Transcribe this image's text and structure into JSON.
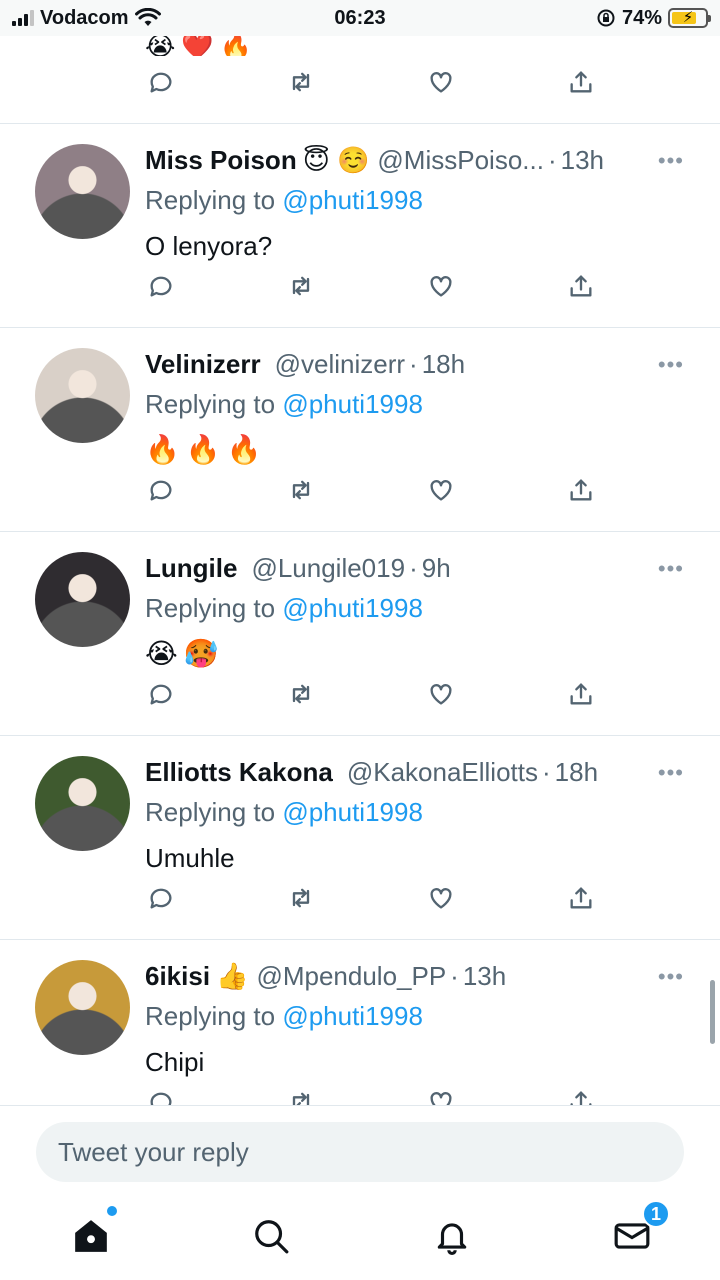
{
  "status_bar": {
    "carrier": "Vodacom",
    "time": "06:23",
    "battery_percent": "74%",
    "battery_level": 0.74
  },
  "top_partial": {
    "emojis": "😭❤️🔥"
  },
  "reply_prefix": "Replying to",
  "tweets": [
    {
      "name": "Miss Poison",
      "name_emoji": "😇 ☺️",
      "handle": "@MissPoiso...",
      "time": "13h",
      "mention": "@phuti1998",
      "text": "O lenyora?",
      "avatar_bg": "#8f7f86"
    },
    {
      "name": "Velinizerr",
      "name_emoji": "",
      "handle": "@velinizerr",
      "time": "18h",
      "mention": "@phuti1998",
      "text": "🔥🔥🔥",
      "avatar_bg": "#d9d0c8"
    },
    {
      "name": "Lungile",
      "name_emoji": "",
      "handle": "@Lungile019",
      "time": "9h",
      "mention": "@phuti1998",
      "text": "😭🥵",
      "avatar_bg": "#2f2c30"
    },
    {
      "name": "Elliotts Kakona",
      "name_emoji": "",
      "handle": "@KakonaElliotts",
      "time": "18h",
      "mention": "@phuti1998",
      "text": "Umuhle",
      "avatar_bg": "#3f5a2f"
    },
    {
      "name": "6ikisi",
      "name_emoji": "👍",
      "handle": "@Mpendulo_PP",
      "time": "13h",
      "mention": "@phuti1998",
      "text": "Chipi",
      "avatar_bg": "#c79a3a"
    }
  ],
  "reply_box": {
    "placeholder": "Tweet your reply"
  },
  "tab_bar": {
    "home": "home-icon",
    "search": "search-icon",
    "notifications": "bell-icon",
    "messages": "mail-icon",
    "messages_badge": "1"
  },
  "colors": {
    "accent": "#1d9bf0",
    "secondary_text": "#536471",
    "divider": "#e1e8ed"
  }
}
